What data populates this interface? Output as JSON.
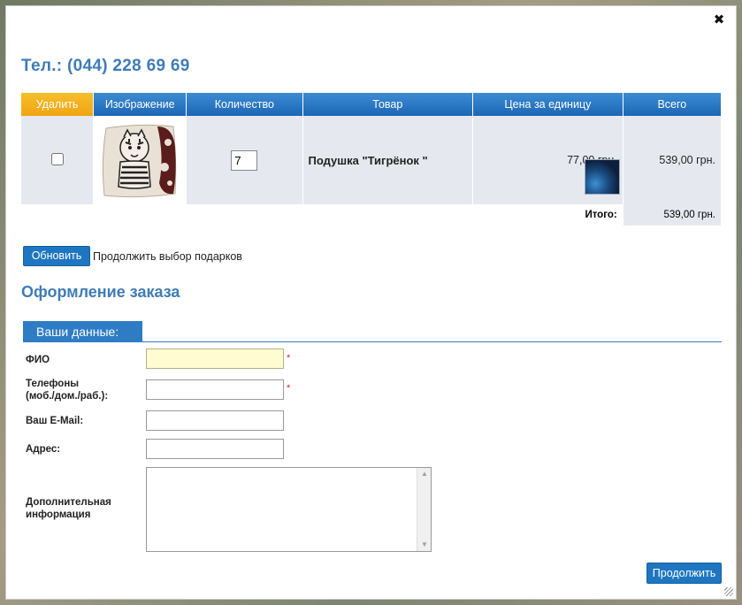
{
  "phone": "Тел.: (044) 228 69 69",
  "cart": {
    "headers": [
      "Удалить",
      "Изображение",
      "Количество",
      "Товар",
      "Цена за единицу",
      "Всего"
    ],
    "items": [
      {
        "quantity": "7",
        "name": "Подушка \"Тигрёнок \"",
        "price": "77,00 грн.",
        "total": "539,00 грн.",
        "image_icon": "tiger-pillow-image"
      }
    ],
    "sum_label": "Итого:",
    "sum_value": "539,00 грн."
  },
  "actions": {
    "update_label": "Обновить",
    "continue_label": "Продолжить выбор подарков"
  },
  "order": {
    "title": "Оформление заказа",
    "section": "Ваши данные:",
    "fields": {
      "name_label": "ФИО",
      "phones_label_1": "Телефоны",
      "phones_label_2": "(моб./дом./раб.):",
      "email_label": "Ваш E-Mail:",
      "address_label": "Адрес:",
      "extra_label_1": "Дополнительная",
      "extra_label_2": "информация",
      "required_mark": "*"
    },
    "submit_label": "Продолжить"
  },
  "colors": {
    "accent": "#3f7cb6",
    "header_blue": "#1d66b5",
    "header_orange": "#f0a512",
    "focus_yellow": "#fefcd0"
  }
}
